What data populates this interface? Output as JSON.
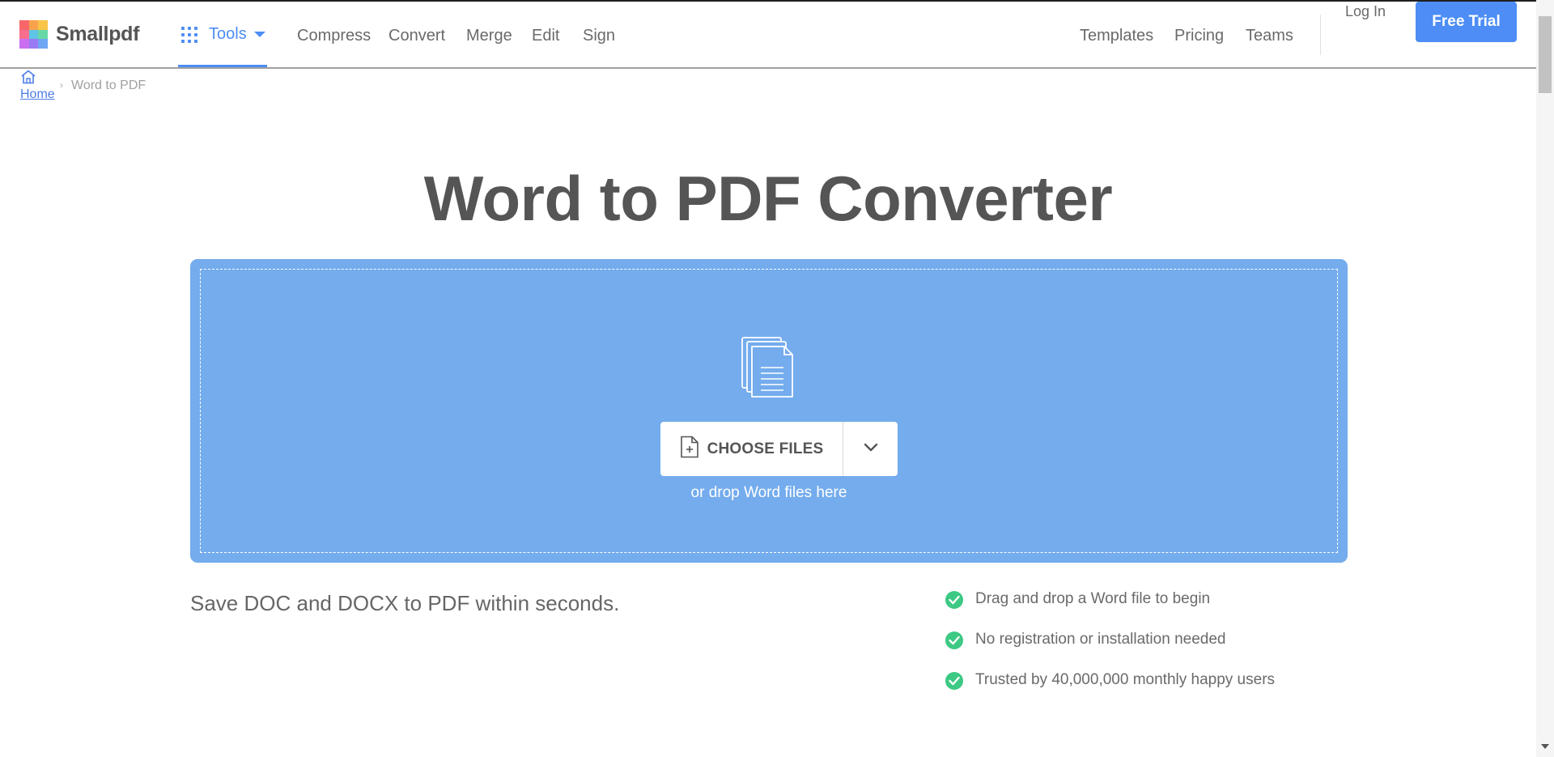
{
  "header": {
    "logo_text": "Smallpdf",
    "tools_label": "Tools",
    "nav_left": [
      "Compress",
      "Convert",
      "Merge",
      "Edit",
      "Sign"
    ],
    "nav_right": [
      "Templates",
      "Pricing",
      "Teams"
    ],
    "login_label": "Log In",
    "free_trial_label": "Free Trial"
  },
  "breadcrumb": {
    "home_label": "Home",
    "separator": "›",
    "current": "Word to PDF"
  },
  "main": {
    "title": "Word to PDF Converter",
    "choose_files_label": "CHOOSE FILES",
    "drop_hint": "or drop Word files here",
    "tagline": "Save DOC and DOCX to PDF within seconds.",
    "features": [
      "Drag and drop a Word file to begin",
      "No registration or installation needed",
      "Trusted by 40,000,000 monthly happy users"
    ]
  },
  "colors": {
    "accent": "#4d8df5",
    "dropzone": "#74aced",
    "check": "#3cc984",
    "title_text": "#555555"
  },
  "icons": {
    "tools": "grid-icon",
    "dropdown": "caret-down-icon",
    "home": "home-icon",
    "dropzone": "documents-icon",
    "choose_files": "file-add-icon",
    "more_options": "chevron-down-icon",
    "feature": "check-circle-icon"
  }
}
